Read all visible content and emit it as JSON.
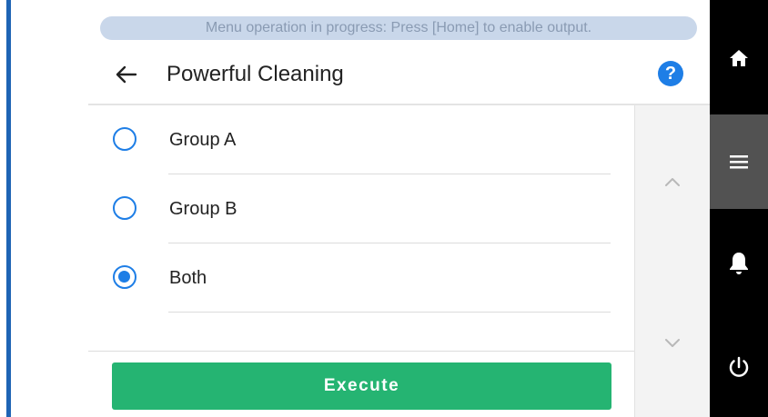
{
  "banner": {
    "text": "Menu operation in progress: Press [Home] to enable output."
  },
  "header": {
    "title": "Powerful Cleaning",
    "help_label": "?"
  },
  "options": [
    {
      "label": "Group A",
      "selected": false
    },
    {
      "label": "Group B",
      "selected": false
    },
    {
      "label": "Both",
      "selected": true
    }
  ],
  "actions": {
    "execute_label": "Execute"
  },
  "sidebar": {
    "items": [
      {
        "icon": "home-icon",
        "active": false
      },
      {
        "icon": "menu-icon",
        "active": true
      },
      {
        "icon": "bell-icon",
        "active": false
      },
      {
        "icon": "power-icon",
        "active": false
      }
    ]
  },
  "colors": {
    "accent": "#1e7ee6",
    "execute": "#25b472",
    "sidebar": "#000000",
    "sidebar_active": "#525252"
  }
}
